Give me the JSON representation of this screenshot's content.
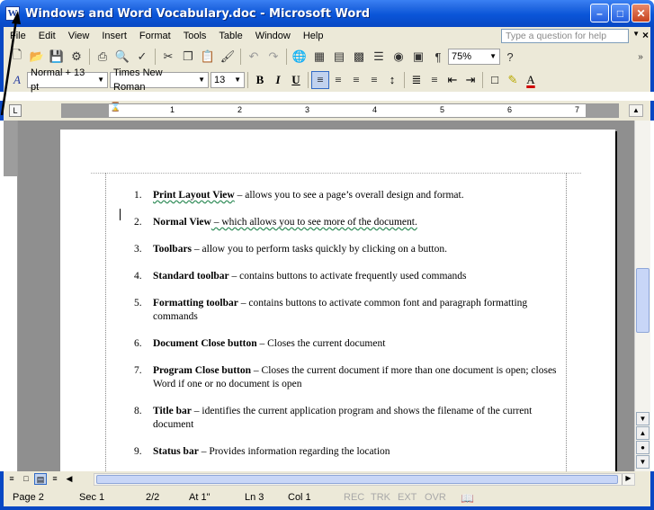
{
  "window": {
    "title": "Windows and Word Vocabulary.doc - Microsoft Word",
    "app_icon": "W"
  },
  "menu": {
    "items": [
      "File",
      "Edit",
      "View",
      "Insert",
      "Format",
      "Tools",
      "Table",
      "Window",
      "Help"
    ],
    "help_placeholder": "Type a question for help"
  },
  "formatting": {
    "style": "Normal + 13 pt",
    "font": "Times New Roman",
    "size": "13",
    "zoom": "75%"
  },
  "ruler": {
    "numbers": [
      "1",
      "2",
      "3",
      "4",
      "5",
      "6",
      "7"
    ]
  },
  "document": {
    "items": [
      {
        "num": "1.",
        "term": "Print Layout View",
        "desc": " – allows you to see a page’s overall design and format."
      },
      {
        "num": "2.",
        "term": "Normal View",
        "desc": " – which allows you to see more of the document."
      },
      {
        "num": "3.",
        "term": "Toolbars",
        "desc": " – allow you to perform tasks quickly by clicking on a button."
      },
      {
        "num": "4.",
        "term": "Standard toolbar",
        "desc": " – contains buttons to activate frequently used commands"
      },
      {
        "num": "5.",
        "term": "Formatting toolbar",
        "desc": " – contains buttons to activate common font and paragraph formatting commands"
      },
      {
        "num": "6.",
        "term": "Document Close button",
        "desc": " – Closes the current document"
      },
      {
        "num": "7.",
        "term": "Program Close button",
        "desc": " – Closes the current document if more than one document is open; closes Word if one or no document is open"
      },
      {
        "num": "8.",
        "term": "Title bar",
        "desc": " – identifies the current application program and shows the filename of the current document"
      },
      {
        "num": "9.",
        "term": "Status bar",
        "desc": " – Provides information regarding the location"
      }
    ]
  },
  "status": {
    "page": "Page 2",
    "sec": "Sec 1",
    "pages": "2/2",
    "at": "At 1\"",
    "ln": "Ln 3",
    "col": "Col 1",
    "rec": "REC",
    "trk": "TRK",
    "ext": "EXT",
    "ovr": "OVR"
  }
}
